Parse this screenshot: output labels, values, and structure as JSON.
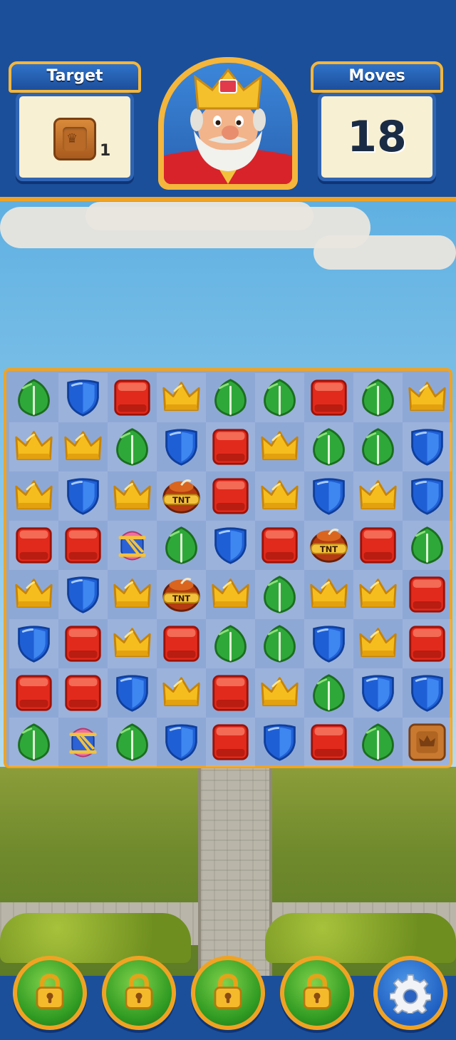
{
  "header": {
    "target_label": "Target",
    "target_count": "1",
    "target_item": "crate-icon",
    "moves_label": "Moves",
    "moves_value": "18",
    "avatar": "king-avatar"
  },
  "board": {
    "rows": 8,
    "cols": 9,
    "grid": [
      [
        "leaf",
        "shield",
        "cube",
        "crown",
        "leaf",
        "leaf",
        "cube",
        "leaf",
        "crown"
      ],
      [
        "crown",
        "crown",
        "leaf",
        "shield",
        "cube",
        "crown",
        "leaf",
        "leaf",
        "shield"
      ],
      [
        "crown",
        "shield",
        "crown",
        "tnt",
        "cube",
        "crown",
        "shield",
        "crown",
        "shield"
      ],
      [
        "cube",
        "cube",
        "lantern",
        "leaf",
        "shield",
        "cube",
        "tnt",
        "cube",
        "leaf"
      ],
      [
        "crown",
        "shield",
        "crown",
        "tnt",
        "crown",
        "leaf",
        "crown",
        "crown",
        "cube"
      ],
      [
        "shield",
        "cube",
        "crown",
        "cube",
        "leaf",
        "leaf",
        "shield",
        "crown",
        "cube"
      ],
      [
        "cube",
        "cube",
        "shield",
        "crown",
        "cube",
        "crown",
        "leaf",
        "shield",
        "shield"
      ],
      [
        "leaf",
        "lantern",
        "leaf",
        "shield",
        "cube",
        "shield",
        "cube",
        "leaf",
        "crate"
      ]
    ]
  },
  "boosters": [
    {
      "name": "booster-1",
      "icon": "lock-icon"
    },
    {
      "name": "booster-2",
      "icon": "lock-icon"
    },
    {
      "name": "booster-3",
      "icon": "lock-icon"
    },
    {
      "name": "booster-4",
      "icon": "lock-icon"
    }
  ],
  "settings_icon": "gear-icon",
  "colors": {
    "header_blue": "#1b4f9a",
    "gold": "#f0a323",
    "leaf": "#2fa83a",
    "shield": "#1f5fd6",
    "cube": "#e22a1c",
    "crown": "#f5bd1e"
  }
}
